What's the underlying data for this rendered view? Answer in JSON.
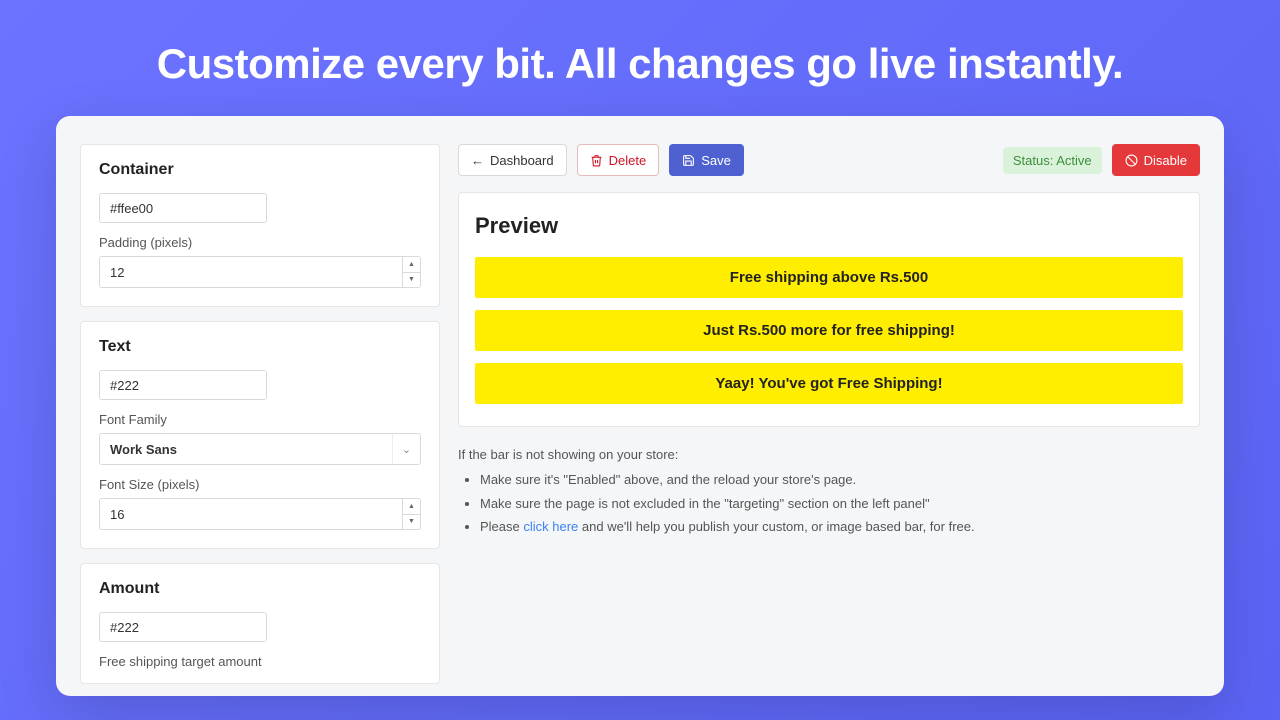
{
  "hero": {
    "headline": "Customize every bit. All changes go live instantly."
  },
  "toolbar": {
    "dashboard_label": "Dashboard",
    "delete_label": "Delete",
    "save_label": "Save",
    "status_label": "Status: Active",
    "disable_label": "Disable"
  },
  "sidebar": {
    "container": {
      "title": "Container",
      "color_value": "#ffee00",
      "swatch": "#ffee00",
      "padding_label": "Padding (pixels)",
      "padding_value": "12"
    },
    "text": {
      "title": "Text",
      "color_value": "#222",
      "swatch": "#222222",
      "font_family_label": "Font Family",
      "font_family_value": "Work Sans",
      "font_size_label": "Font Size (pixels)",
      "font_size_value": "16"
    },
    "amount": {
      "title": "Amount",
      "color_value": "#222",
      "swatch": "#222222",
      "target_label": "Free shipping target amount"
    }
  },
  "preview": {
    "title": "Preview",
    "bars": {
      "0": "Free shipping above Rs.500",
      "1": "Just Rs.500 more for free shipping!",
      "2": "Yaay! You've got Free Shipping!"
    }
  },
  "help": {
    "intro": "If the bar is not showing on your store:",
    "items": {
      "0": "Make sure it's \"Enabled\" above, and the reload your store's page.",
      "1": "Make sure the page is not excluded in the \"targeting\" section on the left panel\"",
      "2a": "Please ",
      "2link": "click here",
      "2b": " and we'll help you publish your custom, or image based bar, for free."
    }
  }
}
